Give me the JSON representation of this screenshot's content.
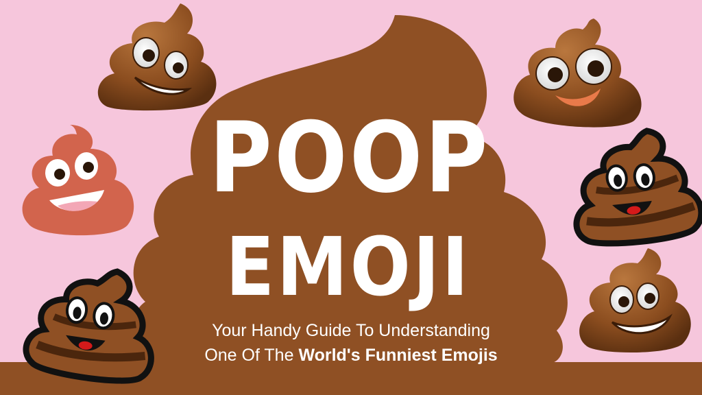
{
  "title": {
    "line1": "POOP",
    "line2": "EMOJI"
  },
  "subtitle": {
    "line1": "Your Handy Guide To Understanding",
    "line2_prefix": "One Of The",
    "line2_bold": "World's Funniest Emojis"
  },
  "colors": {
    "background": "#f6c6dc",
    "brown": "#8f5024",
    "text": "#ffffff"
  },
  "emojis": [
    "poop-emoji-icon-apple",
    "poop-emoji-icon-blob",
    "poop-emoji-icon-salmon",
    "poop-emoji-icon-outlined",
    "poop-emoji-icon-outlined",
    "poop-emoji-icon-apple"
  ]
}
